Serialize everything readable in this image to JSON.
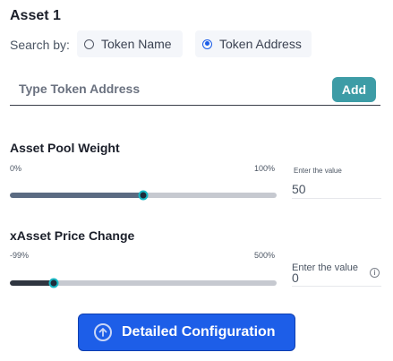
{
  "asset": {
    "title": "Asset 1"
  },
  "search": {
    "label": "Search by:",
    "options": [
      {
        "label": "Token Name",
        "selected": false
      },
      {
        "label": "Token Address",
        "selected": true
      }
    ]
  },
  "token_input": {
    "placeholder": "Type Token Address",
    "value": ""
  },
  "add_button": {
    "label": "Add"
  },
  "pool_weight": {
    "title": "Asset Pool Weight",
    "min_label": "0%",
    "max_label": "100%",
    "slider_value_fraction": 0.5,
    "value_caption": "Enter the value",
    "value": "50"
  },
  "price_change": {
    "title": "xAsset Price Change",
    "min_label": "-99%",
    "max_label": "500%",
    "slider_value_fraction": 0.165,
    "value_caption": "Enter the value",
    "value": "0"
  },
  "detailed_button": {
    "label": "Detailed Configuration"
  },
  "colors": {
    "accent_blue": "#1d5ee8",
    "add_teal": "#3d9ca6",
    "pool_fill": "#5b6b82",
    "price_fill": "#2f3540",
    "thumb_ring": "#19b8c4"
  }
}
